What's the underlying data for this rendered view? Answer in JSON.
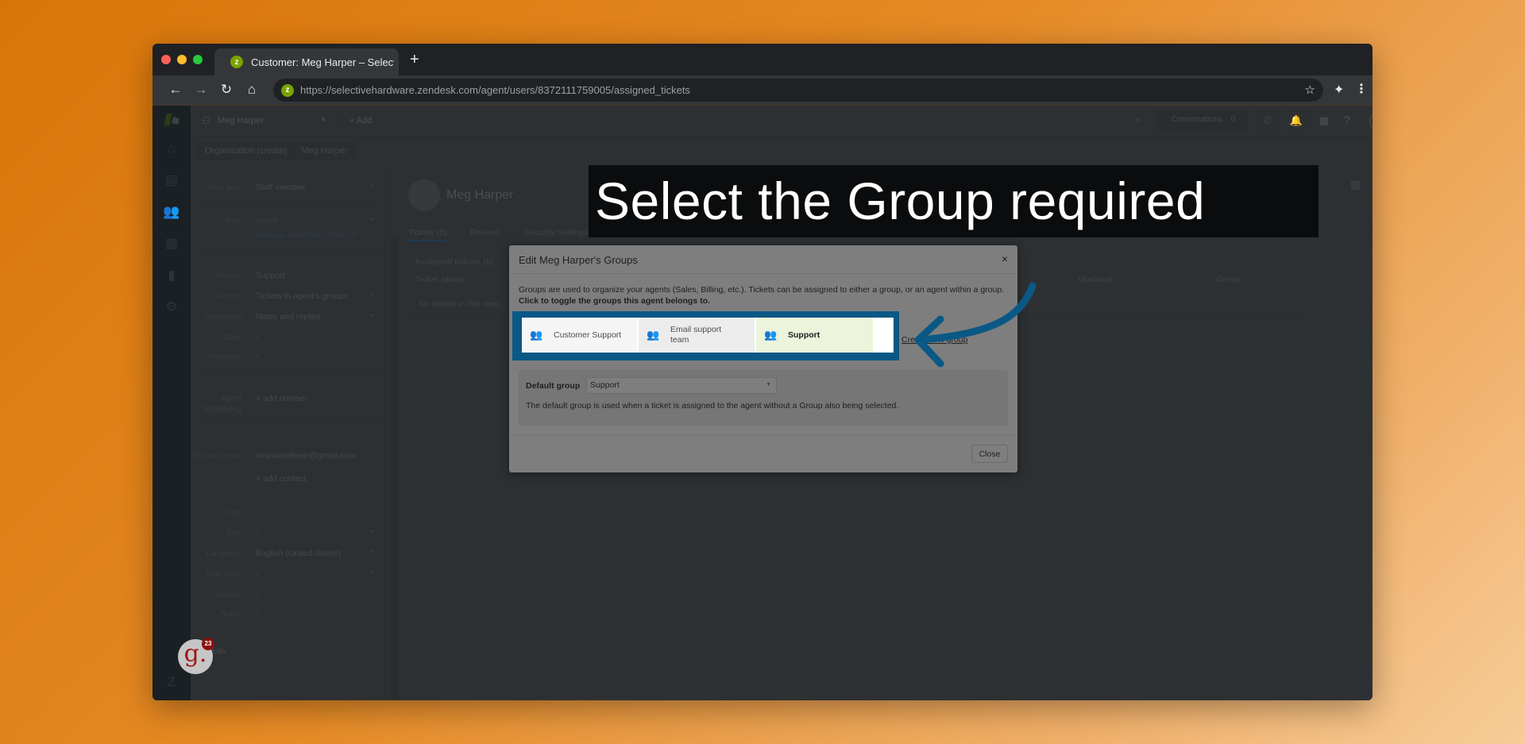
{
  "browser": {
    "tab_title": "Customer: Meg Harper – Selective Hardware",
    "favicon_letter": "z",
    "new_tab_symbol": "+",
    "url": "https://selectivehardware.zendesk.com/agent/users/8372111759005/assigned_tickets",
    "icons": {
      "back": "←",
      "forward": "→",
      "reload": "↻",
      "home": "⌂",
      "star": "☆",
      "extensions": "✦",
      "menu": "⋮"
    }
  },
  "app": {
    "nav_icons": [
      "home-icon",
      "views-icon",
      "customers-icon",
      "organizations-icon",
      "reporting-icon",
      "admin-gear-icon"
    ],
    "topbar": {
      "user_tab_label": "Meg Harper",
      "user_tab_close": "×",
      "add_label": "+ Add",
      "conversations_label": "Conversations",
      "conversations_count": "0"
    },
    "breadcrumbs": [
      "Organization (create)",
      "Meg Harper"
    ],
    "user_fields": [
      {
        "label": "User type",
        "value": "Staff member",
        "dropdown": true
      },
      {
        "label": "Role",
        "value": "Agent",
        "dropdown": true
      },
      {
        "label": "",
        "value": "Manage in Admin Center ↗",
        "link": true
      },
      {
        "label": "Groups",
        "value": "Support"
      },
      {
        "label": "Access",
        "value": "Tickets in agent's groups",
        "dropdown": true
      },
      {
        "label": "Comments",
        "value": "Notes and replies",
        "dropdown": true
      },
      {
        "label": "Alias",
        "value": "-"
      },
      {
        "label": "Signature",
        "value": "-"
      },
      {
        "label": "Agent forwarding",
        "value": "+ add number"
      },
      {
        "label": "Primary email",
        "value": "mrsnaomibear@gmail.com"
      },
      {
        "label": "",
        "value": "+ add contact"
      },
      {
        "label": "Tags",
        "value": "-"
      },
      {
        "label": "Org.",
        "value": "-",
        "dropdown": true
      },
      {
        "label": "Language",
        "value": "English (United States)",
        "dropdown": true
      },
      {
        "label": "Time zone",
        "value": "-",
        "dropdown": true
      },
      {
        "label": "Details",
        "value": "-"
      },
      {
        "label": "Notes",
        "value": "-"
      },
      {
        "label": "",
        "value": "Skills"
      }
    ],
    "profile": {
      "name": "Meg Harper",
      "tabs": [
        "Tickets (0)",
        "Related",
        "Security Settings"
      ],
      "view_title": "Assigned tickets (0)",
      "columns": [
        "Ticket status",
        "Updated",
        "Group"
      ],
      "empty_text": "No tickets in this view"
    }
  },
  "modal": {
    "title": "Edit Meg Harper's Groups",
    "close_symbol": "×",
    "description": "Groups are used to organize your agents (Sales, Billing, etc.). Tickets can be assigned to either a group, or an agent within a group.",
    "instruction": "Click to toggle the groups this agent belongs to.",
    "groups": [
      {
        "name": "Customer Support",
        "selected": false
      },
      {
        "name": "Email support team",
        "selected": false
      },
      {
        "name": "Support",
        "selected": true
      }
    ],
    "create_group_link": "Create new group",
    "default_group_label": "Default group",
    "default_group_value": "Support",
    "default_group_help": "The default group is used when a ticket is assigned to the agent without a Group also being selected.",
    "close_button": "Close"
  },
  "annotation": {
    "callout_text": "Select the Group required",
    "highlight_color": "#0a5886"
  },
  "widget": {
    "letter": "g.",
    "badge_count": "23"
  }
}
